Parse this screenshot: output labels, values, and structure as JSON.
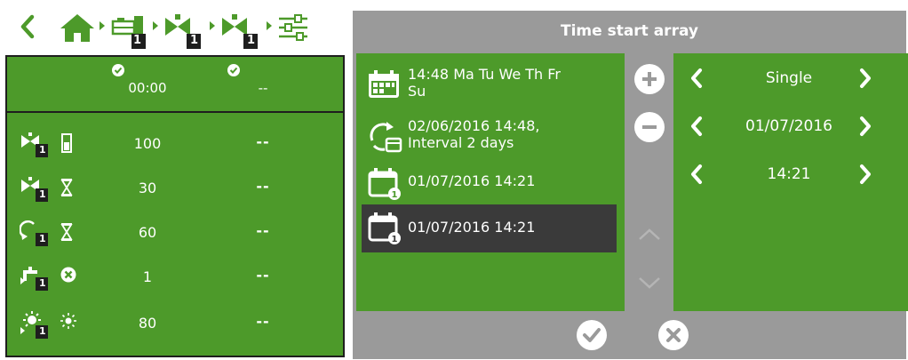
{
  "breadcrumb": {
    "badges": [
      "1",
      "1",
      "1"
    ]
  },
  "left_table": {
    "col1_time": "00:00",
    "col2_time": "--",
    "rows": [
      {
        "icon": "valve-hopper-icon",
        "badge": "1",
        "sub_icon": "tank-level-icon",
        "value": "100",
        "value2": "--"
      },
      {
        "icon": "valve-hourglass-icon",
        "badge": "1",
        "sub_icon": "hourglass-icon",
        "value": "30",
        "value2": "--"
      },
      {
        "icon": "cycle-valve-icon",
        "badge": "1",
        "sub_icon": "hourglass-icon",
        "value": "60",
        "value2": "--"
      },
      {
        "icon": "faucet-icon",
        "badge": "1",
        "sub_icon": "cancel-circle-icon",
        "value": "1",
        "value2": "--"
      },
      {
        "icon": "sun-icon",
        "badge": "1",
        "sub_icon": "sun-small-icon",
        "value": "80",
        "value2": "--"
      }
    ]
  },
  "dialog": {
    "title": "Time start array",
    "list": [
      {
        "icon": "weekly-calendar-icon",
        "line1": "14:48 Ma Tu We Th Fr",
        "line2": "Su",
        "selected": false
      },
      {
        "icon": "interval-cycle-icon",
        "line1": "02/06/2016 14:48,",
        "line2": "Interval 2 days",
        "selected": false
      },
      {
        "icon": "single-calendar-icon",
        "line1": "01/07/2016 14:21",
        "line2": "",
        "selected": false
      },
      {
        "icon": "single-calendar-icon",
        "line1": "01/07/2016 14:21",
        "line2": "",
        "selected": true
      }
    ],
    "editor": {
      "mode": "Single",
      "date": "01/07/2016",
      "time": "14:21"
    },
    "colors": {
      "green": "#4d9a2a",
      "gray": "#9a9a9a",
      "selected": "#3a3a3a"
    }
  }
}
